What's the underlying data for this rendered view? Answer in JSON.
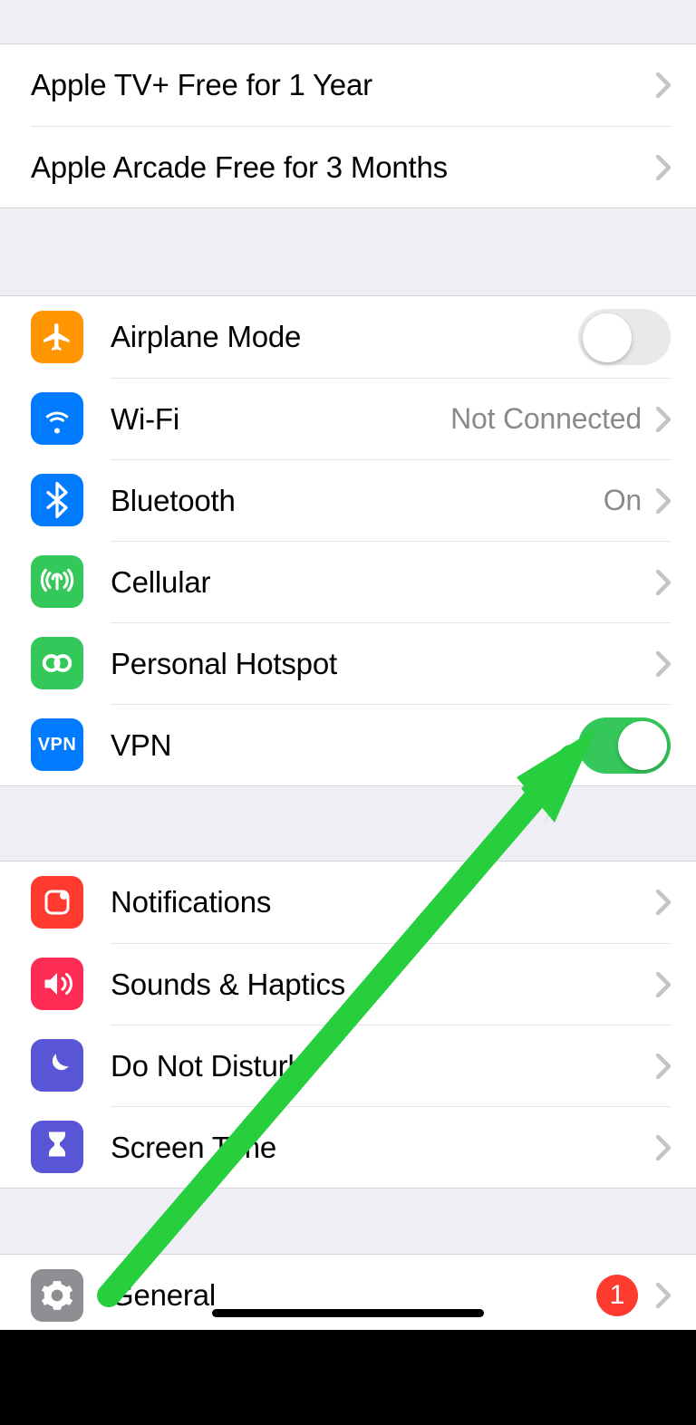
{
  "promos": [
    {
      "label": "Apple TV+ Free for 1 Year"
    },
    {
      "label": "Apple Arcade Free for 3 Months"
    }
  ],
  "connectivity": {
    "airplane": {
      "label": "Airplane Mode",
      "on": false
    },
    "wifi": {
      "label": "Wi-Fi",
      "value": "Not Connected"
    },
    "bluetooth": {
      "label": "Bluetooth",
      "value": "On"
    },
    "cellular": {
      "label": "Cellular"
    },
    "hotspot": {
      "label": "Personal Hotspot"
    },
    "vpn": {
      "label": "VPN",
      "on": true,
      "badge_text": "VPN"
    }
  },
  "prefs": {
    "notifications": {
      "label": "Notifications"
    },
    "sounds": {
      "label": "Sounds & Haptics"
    },
    "dnd": {
      "label": "Do Not Disturb"
    },
    "screentime": {
      "label": "Screen Time"
    }
  },
  "system": {
    "general": {
      "label": "General",
      "badge": "1"
    }
  },
  "colors": {
    "orange": "#ff9500",
    "blue": "#007aff",
    "green": "#34c759",
    "red": "#ff3b30",
    "pink": "#ff2d55",
    "indigo": "#5856d6",
    "gray": "#8e8e93",
    "toggle_on": "#35c759",
    "arrow": "#27cf3f"
  }
}
